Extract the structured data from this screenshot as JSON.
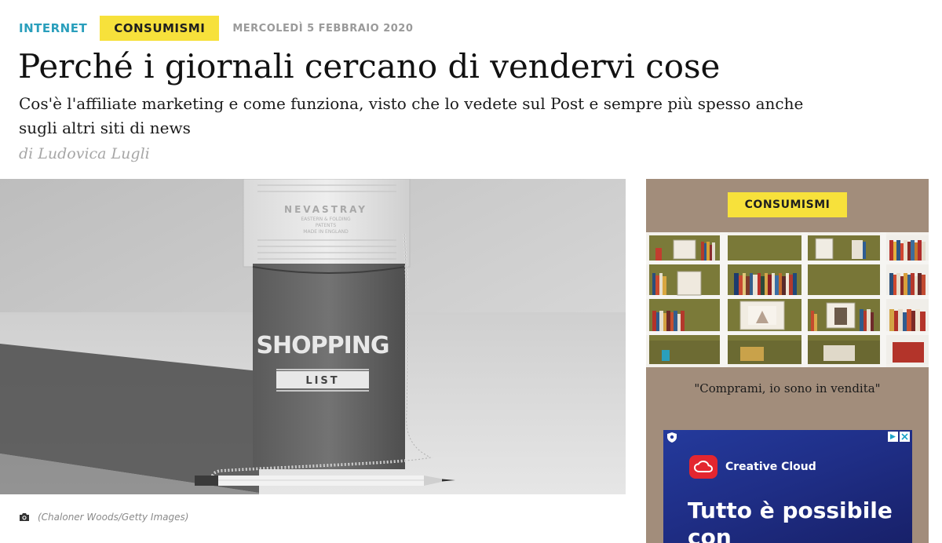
{
  "article": {
    "category_primary": "INTERNET",
    "category_secondary": "CONSUMISMI",
    "date": "MERCOLEDÌ 5 FEBBRAIO 2020",
    "headline": "Perché i giornali cercano di vendervi cose",
    "subtitle": "Cos'è l'affiliate marketing e come funziona, visto che lo vedete sul Post e sempre più spesso anche sugli altri siti di news",
    "author": "di Ludovica Lugli"
  },
  "main_image": {
    "alt": "Shopping list vintage",
    "caption": "(Chaloner Woods/Getty Images)",
    "caption_icon": "camera-icon",
    "pad_lines": [
      "NEVASTRAY",
      "EASTERN & FOLDING",
      "PATENTS",
      "MADE IN ENGLAND"
    ],
    "pocket_text": "SHOPPING",
    "pocket_band": "LIST"
  },
  "sidebar": {
    "tag": "CONSUMISMI",
    "caption": "\"Comprami, io sono in vendita\"",
    "image_alt": "Libreria con oggetti"
  },
  "ad": {
    "brand": "Creative Cloud",
    "headline": "Tutto è possibile con",
    "choices_icon": "adchoices-icon",
    "close_icon": "close-icon"
  },
  "colors": {
    "accent_blue": "#2a9fbc",
    "tag_yellow": "#f7e13b",
    "sidebar_bg": "#a28d7b",
    "ad_blue": "#243a9c",
    "adobe_red": "#e3262f"
  }
}
